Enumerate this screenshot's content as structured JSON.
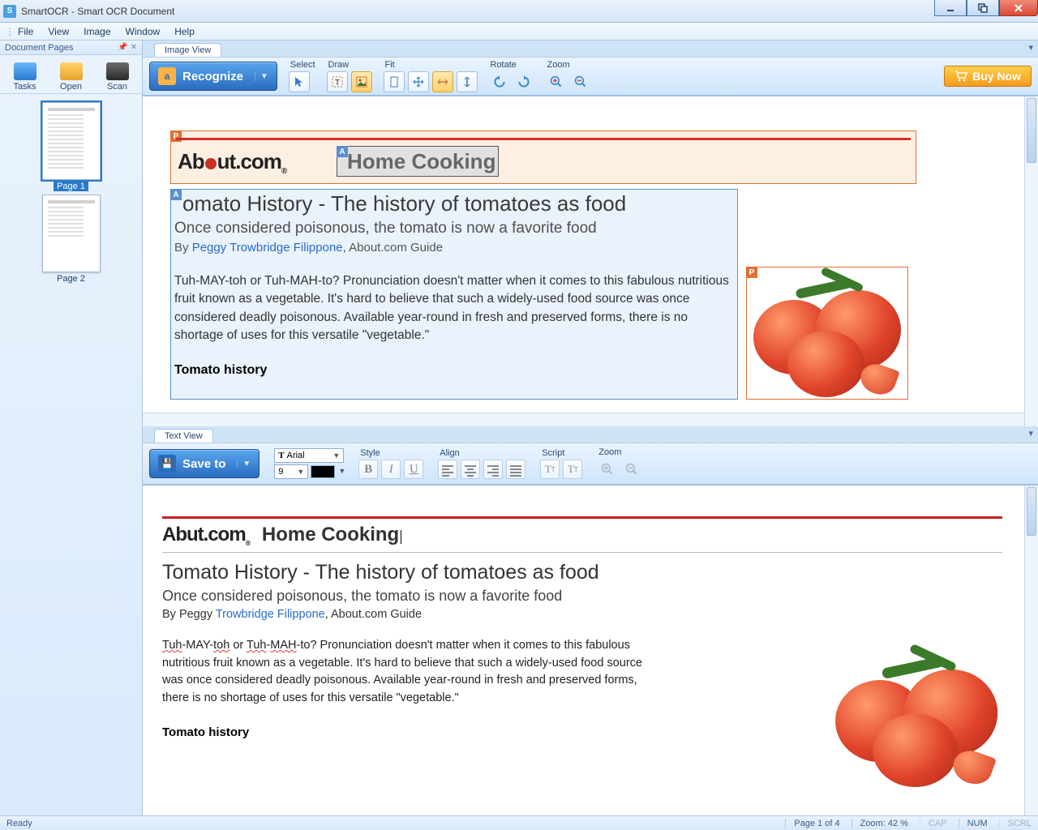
{
  "window": {
    "title": "SmartOCR - Smart OCR Document"
  },
  "menu": {
    "file": "File",
    "view": "View",
    "image": "Image",
    "window": "Window",
    "help": "Help"
  },
  "sidebar": {
    "header": "Document Pages",
    "buttons": {
      "tasks": "Tasks",
      "open": "Open",
      "scan": "Scan"
    },
    "pages": [
      {
        "label": "Page 1"
      },
      {
        "label": "Page 2"
      }
    ]
  },
  "imageview": {
    "tab": "Image View",
    "recognize": "Recognize",
    "buynow": "Buy Now",
    "groups": {
      "select": "Select",
      "draw": "Draw",
      "fit": "Fit",
      "rotate": "Rotate",
      "zoom": "Zoom"
    }
  },
  "textview": {
    "tab": "Text View",
    "saveto": "Save to",
    "font": "Arial",
    "size": "9",
    "groups": {
      "style": "Style",
      "align": "Align",
      "script": "Script",
      "zoom": "Zoom"
    }
  },
  "article": {
    "brand_a": "Ab",
    "brand_b": "ut",
    "brand_c": ".com",
    "section": "Home Cooking",
    "title_iv": "omato History - The history of tomatoes as food",
    "title_tv": "Tomato History - The history of  tomatoes  as  food",
    "subtitle_iv": "Once considered poisonous, the tomato is now a favorite food",
    "subtitle_tv": "Once considered poisonous, the tomato is now a  favorite food",
    "byline_pre": "By ",
    "author": "Peggy Trowbridge Filippone",
    "author_tv_pre": "By Peggy ",
    "author_tv_link": "Trowbridge Filippone",
    "byline_post": ", About.com Guide",
    "body": "Tuh-MAY-toh or Tuh-MAH-to? Pronunciation doesn't matter when it comes to this fabulous nutritious fruit known as a vegetable. It's hard to believe that such a widely-used food source was once considered deadly poisonous. Available year-round in fresh and preserved forms, there is no shortage of uses for this versatile \"vegetable.\"",
    "body_tv_pre": "Tuh",
    "body_tv_mid1": "-MAY-",
    "body_tv_w1": "toh",
    "body_tv_mid2": " or ",
    "body_tv_w2": "Tuh",
    "body_tv_mid3": "-",
    "body_tv_w3": "MAH",
    "body_tv_rest": "-to? Pronunciation doesn't matter when it comes to this fabulous nutritious fruit known as a vegetable. It's hard to believe that such a widely-used food source was once considered deadly poisonous. Available year-round in fresh and preserved forms, there is no shortage of uses for this versatile \"vegetable.\"",
    "subhead": "Tomato history"
  },
  "status": {
    "ready": "Ready",
    "page": "Page 1 of 4",
    "zoom": "Zoom: 42 %",
    "cap": "CAP",
    "num": "NUM",
    "scrl": "SCRL"
  }
}
